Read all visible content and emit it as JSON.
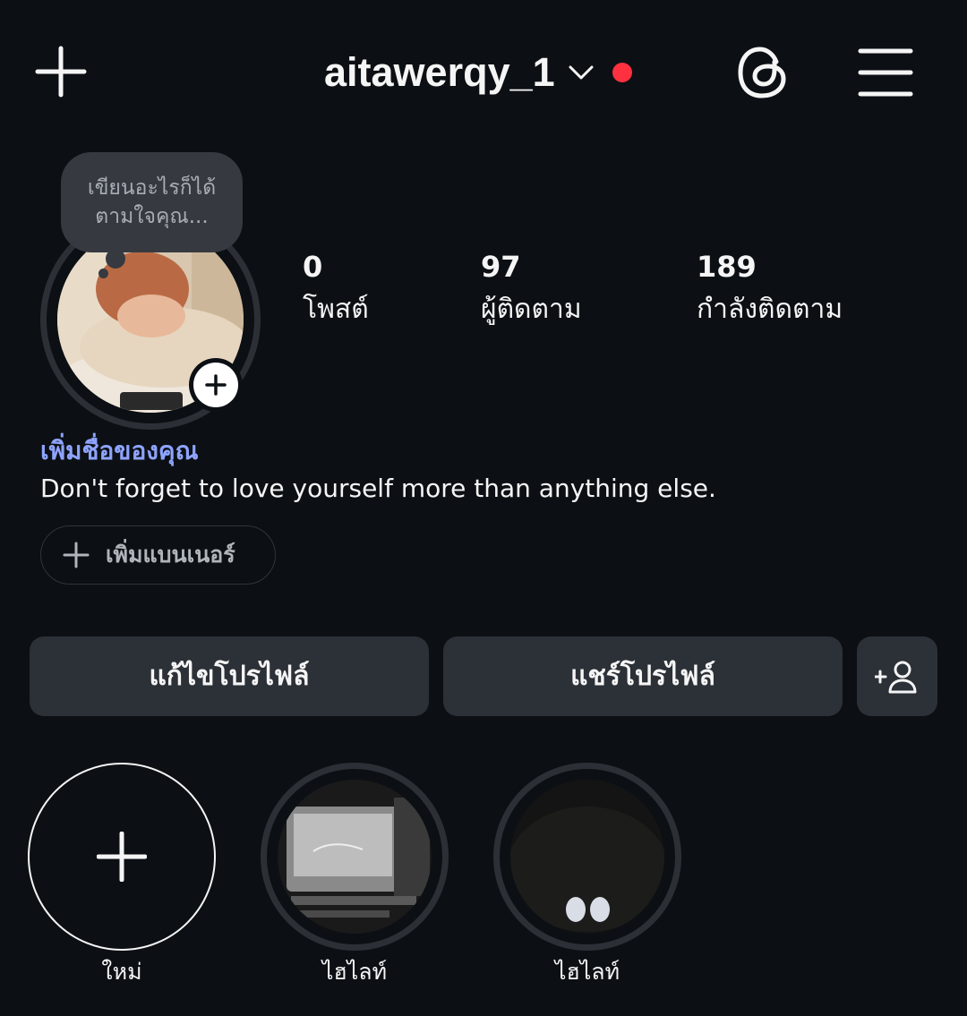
{
  "header": {
    "username": "aitawerqy_1",
    "icons": [
      "plus-icon",
      "chevron-down-icon",
      "threads-icon",
      "menu-icon"
    ],
    "notification_dot_color": "#ff3040"
  },
  "profile": {
    "note_line1": "เขียนอะไรก็ได้",
    "note_line2": "ตามใจคุณ...",
    "add_name": "เพิ่มชื่อของคุณ",
    "bio": "Don't forget to love yourself more than anything else.",
    "banner_button": "เพิ่มแบนเนอร์"
  },
  "stats": [
    {
      "value": "0",
      "label": "โพสต์"
    },
    {
      "value": "97",
      "label": "ผู้ติดตาม"
    },
    {
      "value": "189",
      "label": "กำลังติดตาม"
    }
  ],
  "actions": {
    "edit_profile": "แก้ไขโปรไฟล์",
    "share_profile": "แชร์โปรไฟล์"
  },
  "highlights": [
    {
      "label": "ใหม่"
    },
    {
      "label": "ไฮไลท์"
    },
    {
      "label": "ไฮไลท์"
    }
  ],
  "colors": {
    "background": "#0c1014",
    "button": "#2c3037",
    "link_name": "#8ea4ff"
  }
}
